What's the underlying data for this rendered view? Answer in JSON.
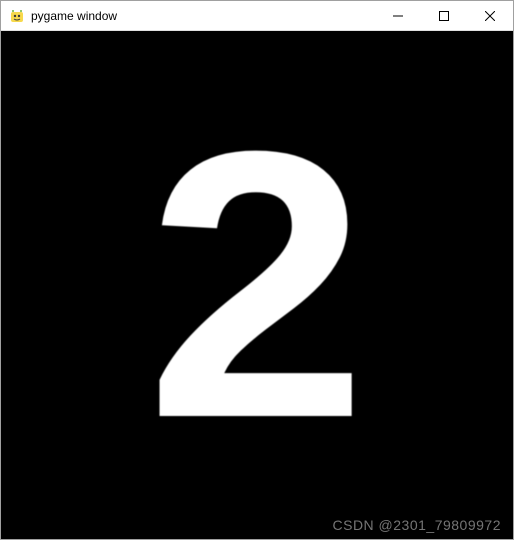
{
  "window": {
    "title": "pygame window"
  },
  "content": {
    "digit": "2"
  },
  "watermark": {
    "text": "CSDN @2301_79809972"
  }
}
